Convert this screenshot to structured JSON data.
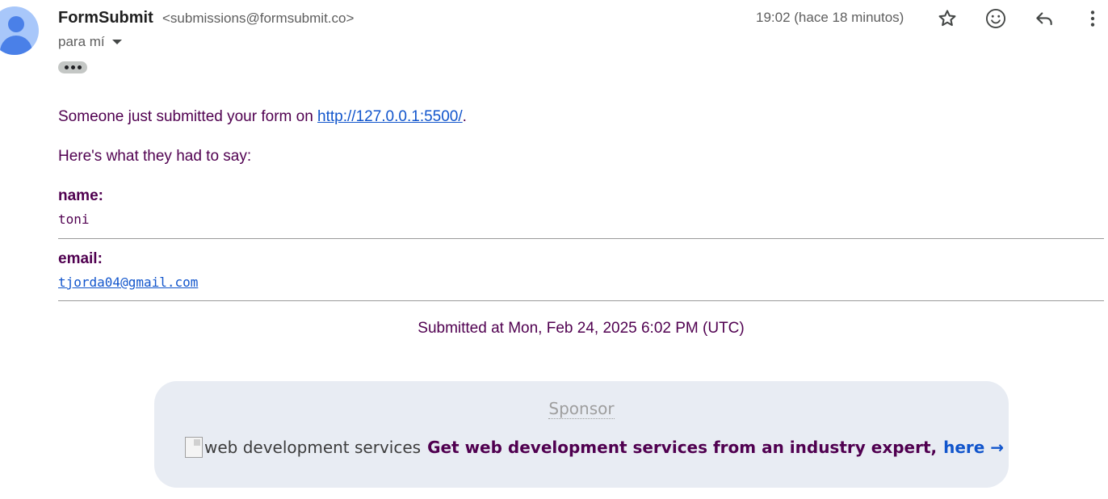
{
  "email": {
    "sender_name": "FormSubmit",
    "sender_email": "<submissions@formsubmit.co>",
    "to": "para mí",
    "time": "19:02 (hace 18 minutos)"
  },
  "body": {
    "intro_text": "Someone just submitted your form on ",
    "intro_link": "http://127.0.0.1:5500/",
    "intro_end": ".",
    "subtitle": "Here's what they had to say:",
    "fields": [
      {
        "label": "name:",
        "value": "toni"
      },
      {
        "label": "email:",
        "value": "tjorda04@gmail.com"
      }
    ],
    "submitted_at": "Submitted at Mon, Feb 24, 2025 6:02 PM (UTC)"
  },
  "sponsor": {
    "title": "Sponsor",
    "image_alt": "web development services",
    "pitch": "Get web development services from an industry expert,",
    "link_text": "here →"
  },
  "icons": [
    "avatar-icon",
    "star-icon",
    "emoji-icon",
    "reply-icon",
    "more-vert-icon",
    "caret-down-icon"
  ],
  "colors": {
    "body_text": "#500050",
    "link": "#1155cc",
    "sponsor_bg": "#e8ecf3"
  }
}
